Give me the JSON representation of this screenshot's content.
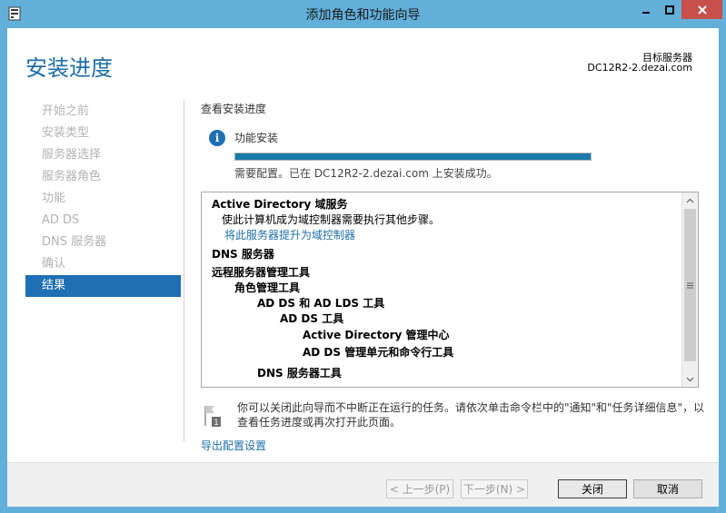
{
  "window": {
    "title": "添加角色和功能向导"
  },
  "header": {
    "page_title": "安装进度",
    "target_label": "目标服务器",
    "target_value": "DC12R2-2.dezai.com"
  },
  "nav": {
    "items": [
      {
        "label": "开始之前"
      },
      {
        "label": "安装类型"
      },
      {
        "label": "服务器选择"
      },
      {
        "label": "服务器角色"
      },
      {
        "label": "功能"
      },
      {
        "label": "AD DS"
      },
      {
        "label": "DNS 服务器"
      },
      {
        "label": "确认"
      },
      {
        "label": "结果"
      }
    ],
    "active_index": 8
  },
  "content": {
    "section_label": "查看安装进度",
    "feature_label": "功能安装",
    "progress": 1.0,
    "status": "需要配置。已在 DC12R2-2.dezai.com 上安装成功。",
    "results": [
      {
        "text": "Active Directory 域服务",
        "bold": true
      },
      {
        "text": "使此计算机成为域控制器需要执行其他步骤。",
        "bold": false
      },
      {
        "text": "将此服务器提升为域控制器",
        "link": true
      },
      {
        "text": "DNS 服务器",
        "bold": true
      },
      {
        "text": "远程服务器管理工具",
        "bold": true
      },
      {
        "text": "角色管理工具",
        "bold": true
      },
      {
        "text": "AD DS 和 AD LDS 工具",
        "bold": true
      },
      {
        "text": "AD DS 工具",
        "bold": true
      },
      {
        "text": "Active Directory 管理中心",
        "bold": true
      },
      {
        "text": "AD DS 管理单元和命令行工具",
        "bold": true
      },
      {
        "text": "DNS 服务器工具",
        "bold": true
      }
    ],
    "note": "你可以关闭此向导而不中断正在运行的任务。请依次单击命令栏中的\"通知\"和\"任务详细信息\"，以查看任务进度或再次打开此页面。",
    "note_badge": "1",
    "export_link": "导出配置设置"
  },
  "footer": {
    "prev_label": "< 上一步(P)",
    "next_label": "下一步(N) >",
    "close_label": "关闭",
    "cancel_label": "取消"
  },
  "colors": {
    "title_bar": "#62b0da",
    "accent": "#1e6fb3",
    "progress_fill": "#1a7aa8",
    "link": "#1e6fa8",
    "close_button": "#c7504a"
  },
  "icons": {
    "app": "server-manager-icon",
    "info": "info-icon",
    "note": "flag-notification-icon"
  }
}
